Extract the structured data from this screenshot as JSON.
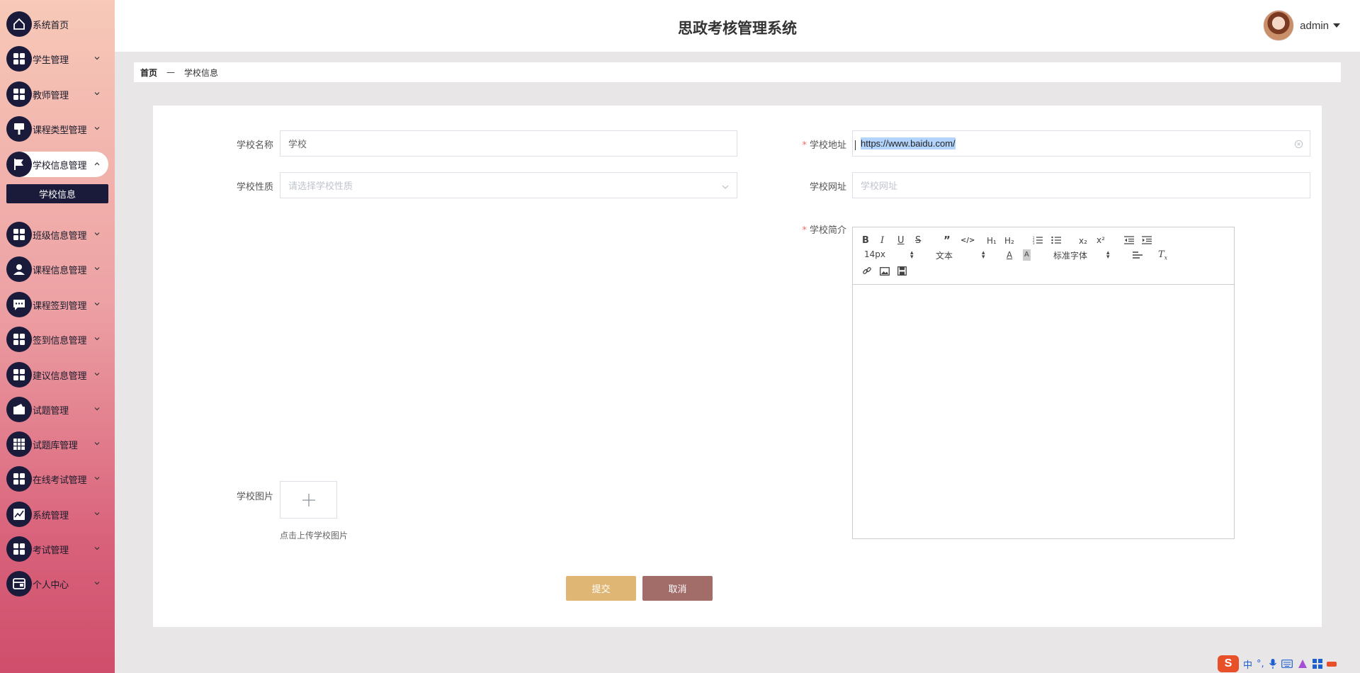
{
  "app_title": "思政考核管理系统",
  "user": {
    "name": "admin"
  },
  "sidebar": {
    "items": [
      {
        "label": "系统首页",
        "icon": "home-icon"
      },
      {
        "label": "学生管理",
        "icon": "grid-icon"
      },
      {
        "label": "教师管理",
        "icon": "grid-icon"
      },
      {
        "label": "课程类型管理",
        "icon": "brush-icon"
      },
      {
        "label": "学校信息管理",
        "icon": "flag-icon",
        "active": true
      },
      {
        "label": "班级信息管理",
        "icon": "grid-icon"
      },
      {
        "label": "课程信息管理",
        "icon": "user-icon"
      },
      {
        "label": "课程签到管理",
        "icon": "chat-icon"
      },
      {
        "label": "签到信息管理",
        "icon": "grid-icon"
      },
      {
        "label": "建议信息管理",
        "icon": "grid-icon"
      },
      {
        "label": "试题管理",
        "icon": "wallet-icon"
      },
      {
        "label": "试题库管理",
        "icon": "table-icon"
      },
      {
        "label": "在线考试管理",
        "icon": "grid-icon"
      },
      {
        "label": "系统管理",
        "icon": "chart-icon"
      },
      {
        "label": "考试管理",
        "icon": "grid-icon"
      },
      {
        "label": "个人中心",
        "icon": "card-icon"
      }
    ],
    "submenu": {
      "label": "学校信息"
    }
  },
  "breadcrumb": {
    "home": "首页",
    "separator": "—",
    "current": "学校信息"
  },
  "form": {
    "name": {
      "label": "学校名称",
      "value": "学校"
    },
    "address": {
      "label": "学校地址",
      "value": "https://www.baidu.com/"
    },
    "nature": {
      "label": "学校性质",
      "placeholder": "请选择学校性质"
    },
    "website": {
      "label": "学校网址",
      "placeholder": "学校网址"
    },
    "intro": {
      "label": "学校简介"
    },
    "image": {
      "label": "学校图片",
      "tip": "点击上传学校图片"
    },
    "required_mark": "*"
  },
  "editor": {
    "font_size": "14px",
    "block_type": "文本",
    "font_family": "标准字体",
    "h1": "H₁",
    "h2": "H₂",
    "sub": "x₂",
    "sup": "x²"
  },
  "buttons": {
    "submit": "提交",
    "cancel": "取消"
  },
  "tray": {
    "ime": "中"
  },
  "colors": {
    "accent": "#1a1a3a",
    "submit": "#e0b675",
    "cancel": "#a26c69",
    "required": "#f56c6c"
  }
}
